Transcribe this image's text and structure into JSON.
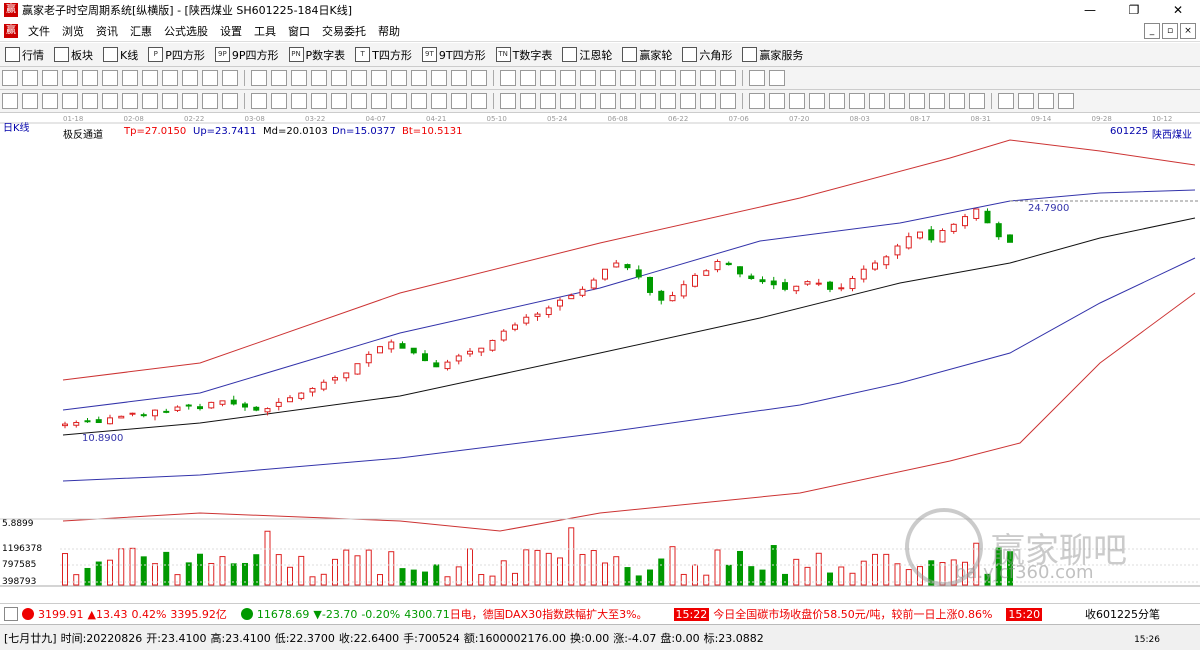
{
  "window": {
    "title": "赢家老子时空周期系统[纵横版] - [陕西煤业  SH601225-184日K线]",
    "minimize": "—",
    "maximize": "❐",
    "close": "✕"
  },
  "menu": [
    "文件",
    "浏览",
    "资讯",
    "汇惠",
    "公式选股",
    "设置",
    "工具",
    "窗口",
    "交易委托",
    "帮助"
  ],
  "mdi_buttons": [
    "_",
    "▫",
    "×"
  ],
  "toolbar1": [
    {
      "icon": "grid-icon",
      "label": "行情"
    },
    {
      "icon": "blocks-icon",
      "label": "板块"
    },
    {
      "icon": "kline-icon",
      "label": "K线"
    },
    {
      "icon": "P",
      "label": "P四方形"
    },
    {
      "icon": "9P",
      "label": "9P四方形"
    },
    {
      "icon": "PN",
      "label": "P数字表"
    },
    {
      "icon": "T",
      "label": "T四方形"
    },
    {
      "icon": "9T",
      "label": "9T四方形"
    },
    {
      "icon": "TN",
      "label": "T数字表"
    },
    {
      "icon": "wheel-icon",
      "label": "江恩轮"
    },
    {
      "icon": "wheel-icon",
      "label": "赢家轮"
    },
    {
      "icon": "hex-icon",
      "label": "六角形"
    },
    {
      "icon": "service-icon",
      "label": "赢家服务"
    }
  ],
  "chart_header": {
    "period_label": "日K线",
    "indicator_name": "极反通道",
    "tp": "Tp=27.0150",
    "up": "Up=23.7411",
    "md": "Md=20.0103",
    "dn": "Dn=15.0377",
    "bt": "Bt=10.5131",
    "code": "601225",
    "stock_name": "陕西煤业"
  },
  "dates": [
    "01-18",
    "02-08",
    "02-22",
    "03-08",
    "03-22",
    "04-07",
    "04-21",
    "05-10",
    "05-24",
    "06-08",
    "06-22",
    "07-06",
    "07-20",
    "08-03",
    "08-17",
    "08-31",
    "09-14",
    "09-28",
    "10-12"
  ],
  "price_labels": {
    "low": "10.8900",
    "high": "24.7900"
  },
  "volume_axis": [
    "5.8899",
    "1196378",
    "797585",
    "398793"
  ],
  "watermark": {
    "text": "赢家聊吧",
    "url": "ba.yjcf360.com"
  },
  "status1": {
    "sh_index": "3199.91",
    "sh_change": "▲13.43",
    "sh_pct": "0.42%",
    "sh_amount": "3395.92亿",
    "sz_index": "11678.69",
    "sz_change": "▼-23.70",
    "sz_pct": "-0.20%",
    "sz_amount": "4300.71",
    "news1": "日电，德国DAX30指数跌幅扩大至3%。",
    "news_time": "15:22",
    "news2": "今日全国碳市场收盘价58.50元/吨，较前一日上涨0.86%",
    "news_time2": "15:20",
    "right_label": "收601225分笔"
  },
  "status2": {
    "lunar": "[七月廿九]",
    "time": "时间:20220826",
    "open": "开:23.4100",
    "high": "高:23.4100",
    "low": "低:22.3700",
    "close": "收:22.6400",
    "volume": "手:700524",
    "amount": "额:1600002176.00",
    "turnover": "换:0.00",
    "change": "涨:-4.07",
    "pan": "盘:0.00",
    "mark": "标:23.0882",
    "clock": "15:26"
  },
  "chart_data": {
    "type": "candlestick",
    "title": "",
    "series_price": [
      10.9,
      11.0,
      11.1,
      11.0,
      11.3,
      11.4,
      11.6,
      11.5,
      11.8,
      11.7,
      12.0,
      12.1,
      11.9,
      12.3,
      12.4,
      12.2,
      12.0,
      11.8,
      11.9,
      12.3,
      12.6,
      12.9,
      13.2,
      13.6,
      13.9,
      14.2,
      14.8,
      15.4,
      15.9,
      16.2,
      15.8,
      15.5,
      15.0,
      14.6,
      14.9,
      15.3,
      15.6,
      15.8,
      16.3,
      16.9,
      17.3,
      17.8,
      18.0,
      18.4,
      18.9,
      19.2,
      19.6,
      20.2,
      20.9,
      21.3,
      21.0,
      20.4,
      19.4,
      18.9,
      19.2,
      19.9,
      20.5,
      20.8,
      21.4,
      21.2,
      20.6,
      20.3,
      20.1,
      19.9,
      19.6,
      19.8,
      20.1,
      20.0,
      19.6,
      19.7,
      20.3,
      20.9,
      21.3,
      21.7,
      22.4,
      23.0,
      23.3,
      22.8,
      23.4,
      23.8,
      24.3,
      24.79,
      23.9,
      23.0,
      22.64
    ],
    "channel_bands": [
      "Tp",
      "Up",
      "Md",
      "Dn",
      "Bt"
    ]
  }
}
